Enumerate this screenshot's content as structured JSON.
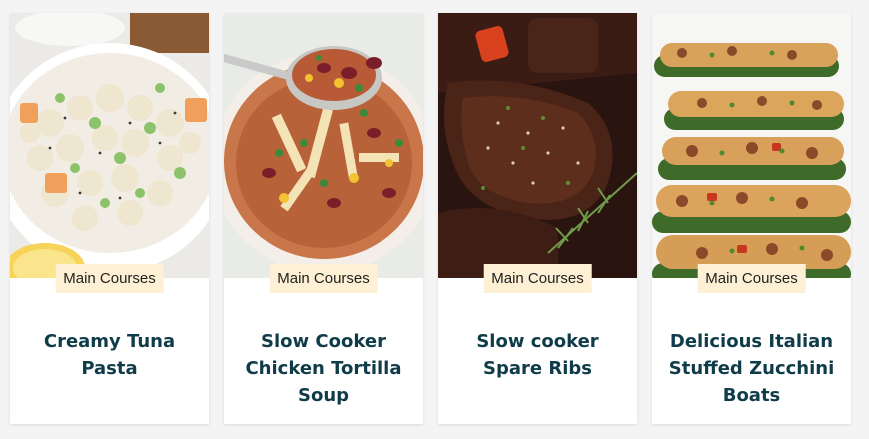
{
  "colors": {
    "title": "#0f3c48",
    "badge_bg": "#fdf0d4",
    "card_bg": "#ffffff"
  },
  "recipes": [
    {
      "category": "Main Courses",
      "title": "Creamy Tuna Pasta",
      "image": "tuna-pasta-salad-photo"
    },
    {
      "category": "Main Courses",
      "title": "Slow Cooker Chicken Tortilla Soup",
      "image": "tortilla-soup-photo"
    },
    {
      "category": "Main Courses",
      "title": "Slow cooker Spare Ribs",
      "image": "spare-ribs-photo"
    },
    {
      "category": "Main Courses",
      "title": "Delicious Italian Stuffed Zucchini Boats",
      "image": "zucchini-boats-photo"
    }
  ]
}
